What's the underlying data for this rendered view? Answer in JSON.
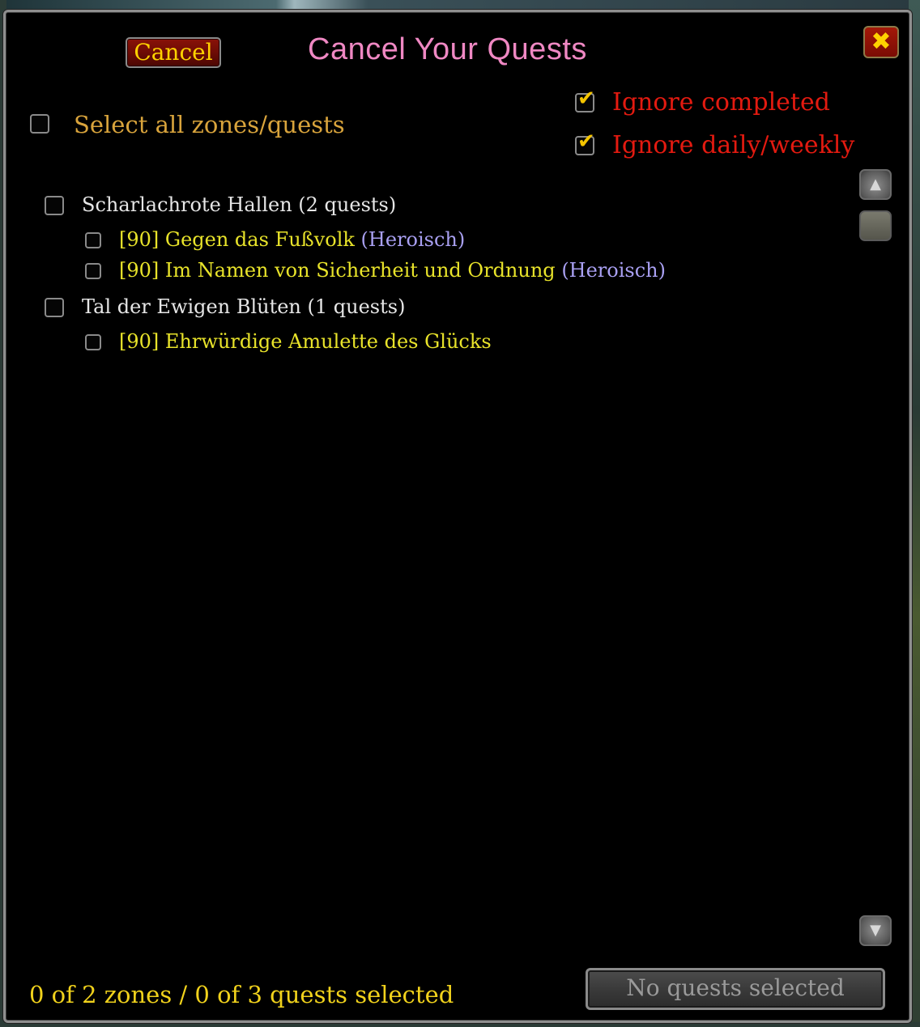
{
  "window": {
    "title": "Cancel Your Quests",
    "cancel_label": "Cancel",
    "close_glyph": "✖"
  },
  "options": {
    "select_all_label": "Select all zones/quests",
    "select_all_checked": false,
    "ignore_completed_label": "Ignore completed",
    "ignore_completed_checked": true,
    "ignore_daily_label": "Ignore daily/weekly",
    "ignore_daily_checked": true
  },
  "zones": [
    {
      "label": "Scharlachrote Hallen (2 quests)",
      "quests": [
        {
          "label": "[90] Gegen das Fußvolk",
          "tag": "(Heroisch)"
        },
        {
          "label": "[90] Im Namen von Sicherheit und Ordnung",
          "tag": "(Heroisch)"
        }
      ]
    },
    {
      "label": "Tal der Ewigen Blüten (1 quests)",
      "quests": [
        {
          "label": "[90] Ehrwürdige Amulette des Glücks",
          "tag": ""
        }
      ]
    }
  ],
  "footer": {
    "status": "0 of 2 zones / 0 of 3 quests selected",
    "action_label": "No quests selected"
  },
  "icons": {
    "scroll_up": "scroll-up-icon",
    "scroll_down": "scroll-down-icon"
  },
  "colors": {
    "title": "#ef88c3",
    "option_red": "#e31a10",
    "select_all": "#d9a43c",
    "quest_yellow": "#e8e32a",
    "heroic": "#a9a0f2",
    "zone": "#e6e6e6"
  }
}
